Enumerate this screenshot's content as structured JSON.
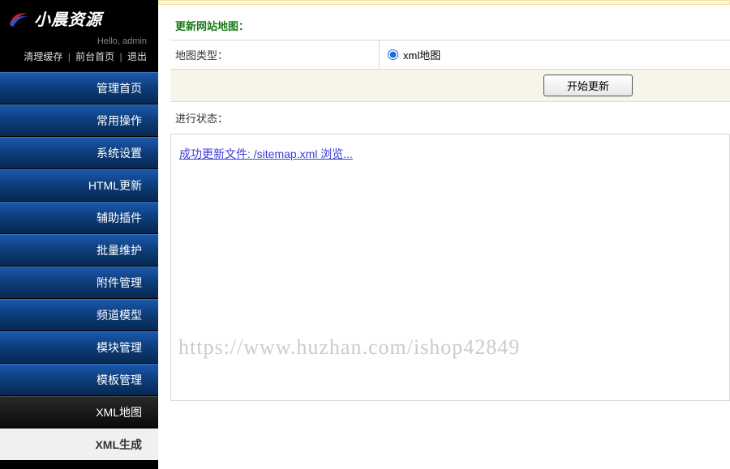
{
  "logo": {
    "text": "小晨资源"
  },
  "user": {
    "greeting": "Hello, admin"
  },
  "userLinks": {
    "clear": "清理缓存",
    "front": "前台首页",
    "logout": "退出"
  },
  "nav": [
    {
      "label": "管理首页",
      "style": "blue"
    },
    {
      "label": "常用操作",
      "style": "blue"
    },
    {
      "label": "系统设置",
      "style": "blue"
    },
    {
      "label": "HTML更新",
      "style": "blue"
    },
    {
      "label": "辅助插件",
      "style": "blue"
    },
    {
      "label": "批量维护",
      "style": "blue"
    },
    {
      "label": "附件管理",
      "style": "blue"
    },
    {
      "label": "频道模型",
      "style": "blue"
    },
    {
      "label": "模块管理",
      "style": "blue"
    },
    {
      "label": "模板管理",
      "style": "blue"
    },
    {
      "label": "XML地图",
      "style": "dark"
    },
    {
      "label": "XML生成",
      "style": "active"
    }
  ],
  "panel": {
    "title": "更新网站地图：",
    "mapTypeLabel": "地图类型：",
    "mapTypeOption": "xml地图",
    "startButton": "开始更新",
    "statusLabel": "进行状态：",
    "resultLink": "成功更新文件: /sitemap.xml 浏览..."
  },
  "watermark": "https://www.huzhan.com/ishop42849"
}
